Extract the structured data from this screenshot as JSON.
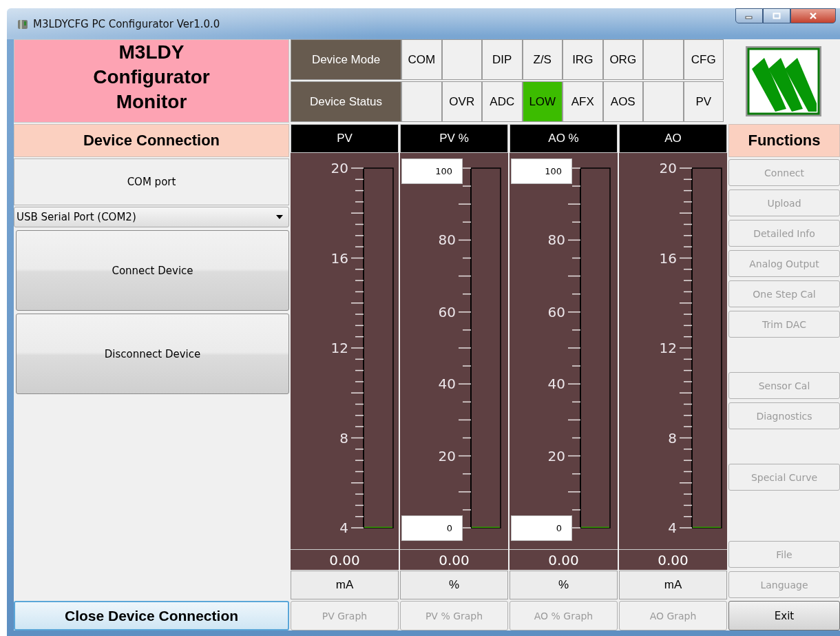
{
  "window": {
    "title": "M3LDYCFG PC Configurator Ver1.0.0"
  },
  "app_title": "M3LDY Configurator Monitor",
  "device_mode": {
    "label": "Device Mode",
    "cells": [
      {
        "label": "COM",
        "on": false
      },
      {
        "on": false
      },
      {
        "label": "DIP",
        "on": false
      },
      {
        "label": "Z/S",
        "on": false
      },
      {
        "label": "IRG",
        "on": false
      },
      {
        "label": "ORG",
        "on": false
      },
      {
        "on": false
      },
      {
        "label": "CFG",
        "on": false
      }
    ]
  },
  "device_status": {
    "label": "Device Status",
    "cells": [
      {
        "on": false
      },
      {
        "label": "OVR",
        "on": false
      },
      {
        "label": "ADC",
        "on": false
      },
      {
        "label": "LOW",
        "on": true
      },
      {
        "label": "AFX",
        "on": false
      },
      {
        "label": "AOS",
        "on": false
      },
      {
        "on": false
      },
      {
        "label": "PV",
        "on": false
      }
    ]
  },
  "connection": {
    "title": "Device Connection",
    "com_port_label": "COM port",
    "com_port": {
      "value": "USB Serial Port (COM2)"
    },
    "connect_button": "Connect Device",
    "disconnect_button": "Disconnect Device",
    "close_button": "Close Device Connection"
  },
  "meters": [
    {
      "title": "PV",
      "kind": "scale",
      "scale_labels": [
        "20",
        "16",
        "12",
        "8",
        "4"
      ],
      "level": 0,
      "value": "0.00",
      "unit": "mA",
      "graph_button": {
        "label": "PV Graph",
        "disabled": true
      }
    },
    {
      "title": "PV %",
      "kind": "range",
      "range_max": "100",
      "range_min": "0",
      "scale_labels": [
        "80",
        "60",
        "40",
        "20"
      ],
      "level": 0,
      "value": "0.00",
      "unit": "%",
      "graph_button": {
        "label": "PV % Graph",
        "disabled": true
      }
    },
    {
      "title": "AO %",
      "kind": "range",
      "range_max": "100",
      "range_min": "0",
      "scale_labels": [
        "80",
        "60",
        "40",
        "20"
      ],
      "level": 0,
      "value": "0.00",
      "unit": "%",
      "graph_button": {
        "label": "AO % Graph",
        "disabled": true
      }
    },
    {
      "title": "AO",
      "kind": "scale",
      "scale_labels": [
        "20",
        "16",
        "12",
        "8",
        "4"
      ],
      "level": 0,
      "value": "0.00",
      "unit": "mA",
      "graph_button": {
        "label": "AO Graph",
        "disabled": true
      }
    }
  ],
  "functions": {
    "title": "Functions",
    "groups": [
      [
        {
          "label": "Connect",
          "disabled": true
        },
        {
          "label": "Upload",
          "disabled": true
        },
        {
          "label": "Detailed Info",
          "disabled": true
        },
        {
          "label": "Analog Output",
          "disabled": true
        },
        {
          "label": "One Step Cal",
          "disabled": true
        },
        {
          "label": "Trim DAC",
          "disabled": true
        }
      ],
      [
        {
          "label": "Sensor Cal",
          "disabled": true
        },
        {
          "label": "Diagnostics",
          "disabled": true
        }
      ],
      [
        {
          "label": "Special Curve",
          "disabled": true
        }
      ],
      [
        {
          "label": "File",
          "disabled": true
        },
        {
          "label": "Language",
          "disabled": true
        }
      ]
    ],
    "exit_button": {
      "label": "Exit",
      "disabled": false
    }
  }
}
